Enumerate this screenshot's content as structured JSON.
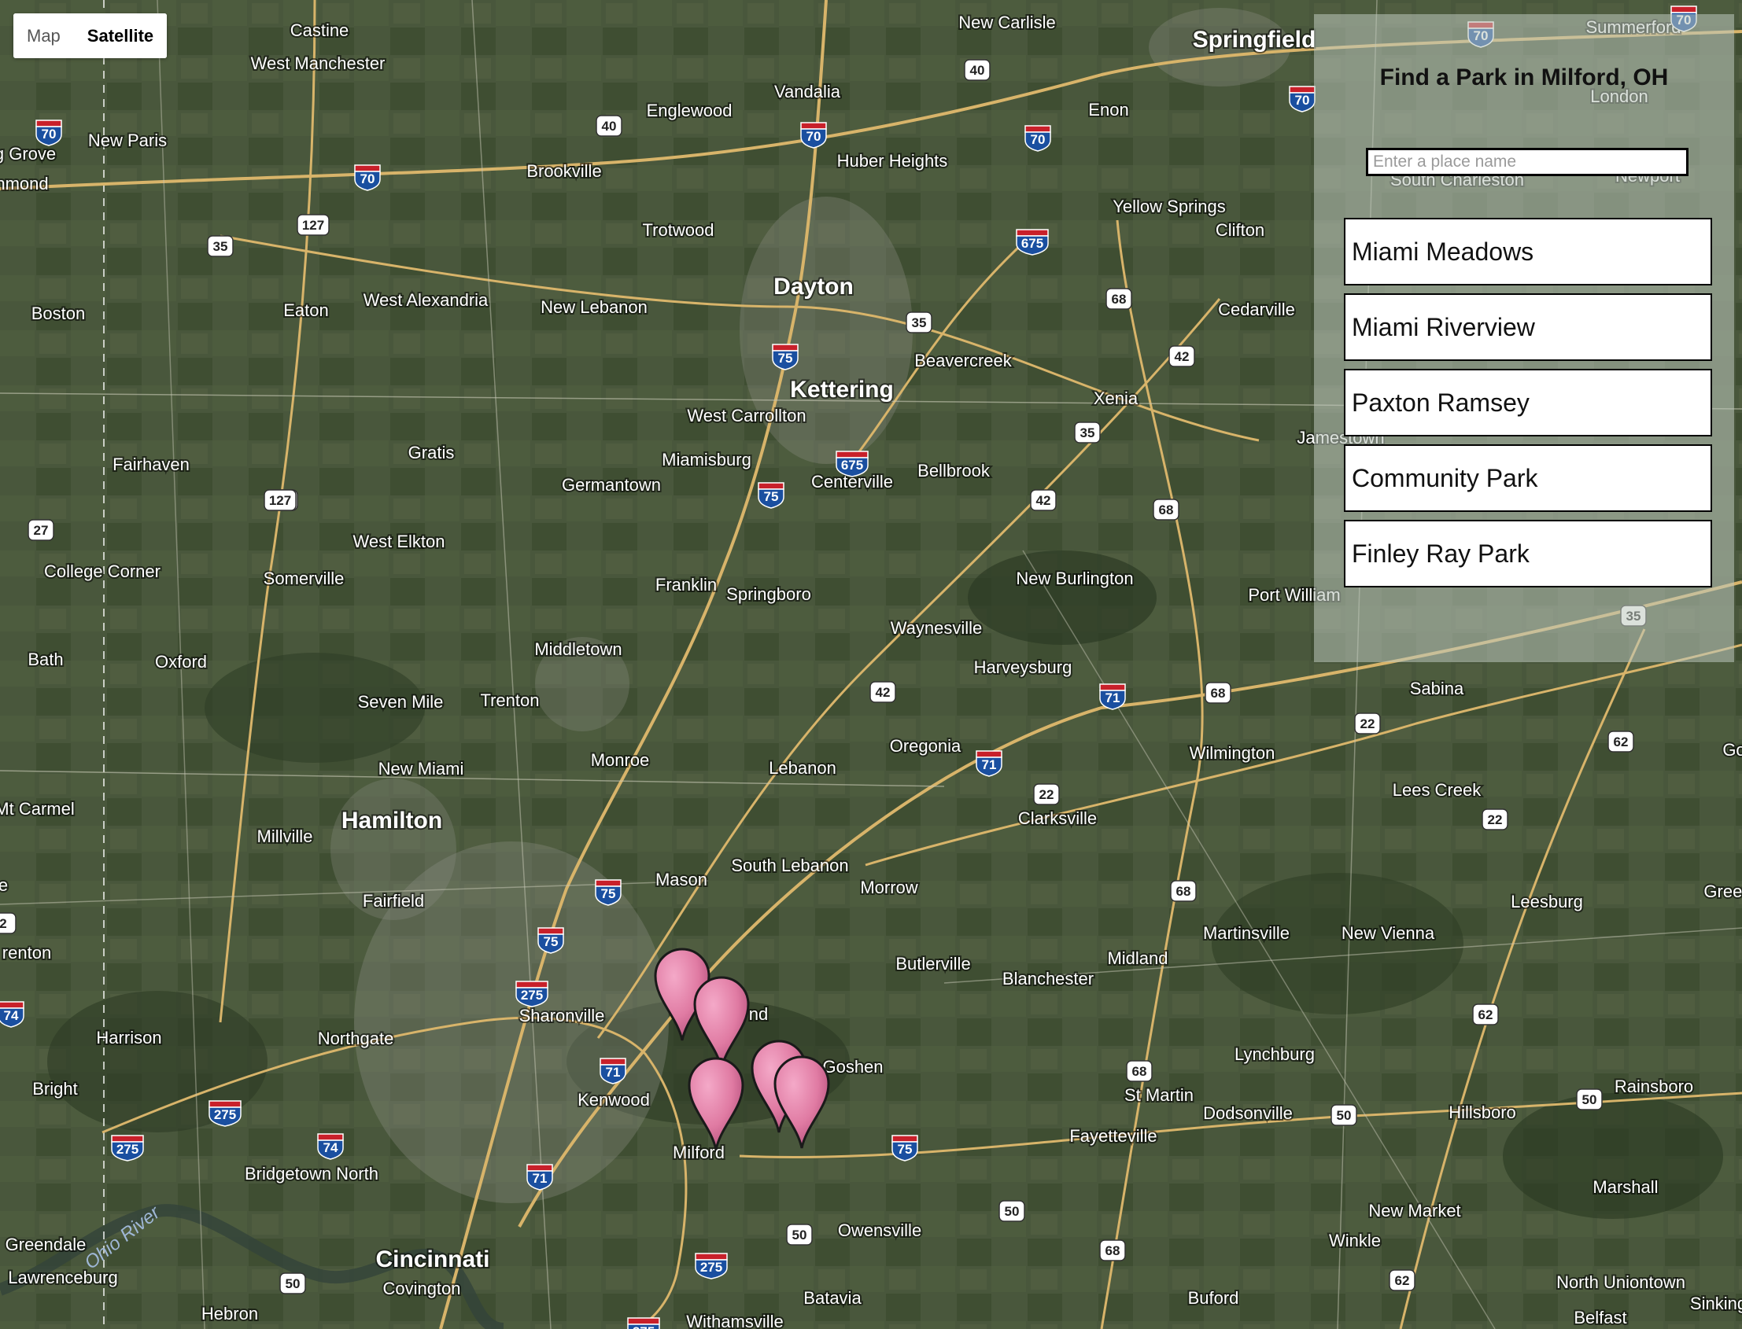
{
  "map_type_control": {
    "options": [
      "Map",
      "Satellite"
    ],
    "selected": "Satellite"
  },
  "panel": {
    "title": "Find a Park in Milford, OH",
    "search_placeholder": "Enter a place name",
    "search_value": "",
    "parks": [
      {
        "name": "Miami Meadows"
      },
      {
        "name": "Miami Riverview"
      },
      {
        "name": "Paxton Ramsey"
      },
      {
        "name": "Community Park"
      },
      {
        "name": "Finley Ray Park"
      }
    ]
  },
  "map": {
    "place_labels": [
      {
        "text": "Springfield",
        "major": true
      },
      {
        "text": "Dayton",
        "major": true
      },
      {
        "text": "Kettering",
        "major": true
      },
      {
        "text": "Hamilton",
        "major": true
      },
      {
        "text": "Cincinnati",
        "major": true
      },
      {
        "text": "Middletown",
        "major": false
      },
      {
        "text": "Xenia",
        "major": false
      },
      {
        "text": "Castine",
        "major": false
      },
      {
        "text": "West Manchester",
        "major": false
      },
      {
        "text": "New Carlisle",
        "major": false
      },
      {
        "text": "Summerford",
        "major": false
      },
      {
        "text": "London",
        "major": false
      },
      {
        "text": "Vandalia",
        "major": false
      },
      {
        "text": "Englewood",
        "major": false
      },
      {
        "text": "Enon",
        "major": false
      },
      {
        "text": "New Paris",
        "major": false
      },
      {
        "text": "g Grove",
        "major": false
      },
      {
        "text": "hmond",
        "major": false
      },
      {
        "text": "Brookville",
        "major": false
      },
      {
        "text": "Huber Heights",
        "major": false
      },
      {
        "text": "Yellow Springs",
        "major": false
      },
      {
        "text": "Clifton",
        "major": false
      },
      {
        "text": "South Charleston",
        "major": false
      },
      {
        "text": "Newport",
        "major": false
      },
      {
        "text": "Trotwood",
        "major": false
      },
      {
        "text": "Boston",
        "major": false
      },
      {
        "text": "Eaton",
        "major": false
      },
      {
        "text": "West Alexandria",
        "major": false
      },
      {
        "text": "New Lebanon",
        "major": false
      },
      {
        "text": "Cedarville",
        "major": false
      },
      {
        "text": "Beavercreek",
        "major": false
      },
      {
        "text": "West Carrollton",
        "major": false
      },
      {
        "text": "Miamisburg",
        "major": false
      },
      {
        "text": "Jamestown",
        "major": false
      },
      {
        "text": "Fairhaven",
        "major": false
      },
      {
        "text": "Gratis",
        "major": false
      },
      {
        "text": "Germantown",
        "major": false
      },
      {
        "text": "Centerville",
        "major": false
      },
      {
        "text": "Bellbrook",
        "major": false
      },
      {
        "text": "West Elkton",
        "major": false
      },
      {
        "text": "College Corner",
        "major": false
      },
      {
        "text": "Somerville",
        "major": false
      },
      {
        "text": "Franklin",
        "major": false
      },
      {
        "text": "Springboro",
        "major": false
      },
      {
        "text": "New Burlington",
        "major": false
      },
      {
        "text": "Port William",
        "major": false
      },
      {
        "text": "Bath",
        "major": false
      },
      {
        "text": "Oxford",
        "major": false
      },
      {
        "text": "Waynesville",
        "major": false
      },
      {
        "text": "Harveysburg",
        "major": false
      },
      {
        "text": "Seven Mile",
        "major": false
      },
      {
        "text": "Trenton",
        "major": false
      },
      {
        "text": "Sabina",
        "major": false
      },
      {
        "text": "Oregonia",
        "major": false
      },
      {
        "text": "Monroe",
        "major": false
      },
      {
        "text": "Lebanon",
        "major": false
      },
      {
        "text": "New Miami",
        "major": false
      },
      {
        "text": "Wilmington",
        "major": false
      },
      {
        "text": "Mt Carmel",
        "major": false
      },
      {
        "text": "Lees Creek",
        "major": false
      },
      {
        "text": "Millville",
        "major": false
      },
      {
        "text": "Clarksville",
        "major": false
      },
      {
        "text": "South Lebanon",
        "major": false
      },
      {
        "text": "Mason",
        "major": false
      },
      {
        "text": "Morrow",
        "major": false
      },
      {
        "text": "Fairfield",
        "major": false
      },
      {
        "text": "Leesburg",
        "major": false
      },
      {
        "text": "Martinsville",
        "major": false
      },
      {
        "text": "New Vienna",
        "major": false
      },
      {
        "text": "renton",
        "major": false
      },
      {
        "text": "Butlerville",
        "major": false
      },
      {
        "text": "Midland",
        "major": false
      },
      {
        "text": "Blanchester",
        "major": false
      },
      {
        "text": "Sharonville",
        "major": false
      },
      {
        "text": "Harrison",
        "major": false
      },
      {
        "text": "Northgate",
        "major": false
      },
      {
        "text": "nd",
        "major": false
      },
      {
        "text": "Goshen",
        "major": false
      },
      {
        "text": "Lynchburg",
        "major": false
      },
      {
        "text": "Bright",
        "major": false
      },
      {
        "text": "Kenwood",
        "major": false
      },
      {
        "text": "St Martin",
        "major": false
      },
      {
        "text": "Rainsboro",
        "major": false
      },
      {
        "text": "Dodsonville",
        "major": false
      },
      {
        "text": "Hillsboro",
        "major": false
      },
      {
        "text": "Fayetteville",
        "major": false
      },
      {
        "text": "Milford",
        "major": false
      },
      {
        "text": "Bridgetown North",
        "major": false
      },
      {
        "text": "Marshall",
        "major": false
      },
      {
        "text": "New Market",
        "major": false
      },
      {
        "text": "Owensville",
        "major": false
      },
      {
        "text": "Greendale",
        "major": false
      },
      {
        "text": "Winkle",
        "major": false
      },
      {
        "text": "Covington",
        "major": false
      },
      {
        "text": "Lawrenceburg",
        "major": false
      },
      {
        "text": "North Uniontown",
        "major": false
      },
      {
        "text": "Batavia",
        "major": false
      },
      {
        "text": "Buford",
        "major": false
      },
      {
        "text": "Hebron",
        "major": false
      },
      {
        "text": "Withamsville",
        "major": false
      },
      {
        "text": "Belfast",
        "major": false
      },
      {
        "text": "Sinking",
        "major": false
      },
      {
        "text": "Green",
        "major": false
      },
      {
        "text": "Go",
        "major": false
      },
      {
        "text": "e",
        "major": false
      }
    ],
    "river_labels": [
      "Ohio River"
    ],
    "route_shields": [
      {
        "number": "70",
        "kind": "interstate"
      },
      {
        "number": "70",
        "kind": "interstate"
      },
      {
        "number": "70",
        "kind": "interstate"
      },
      {
        "number": "70",
        "kind": "interstate"
      },
      {
        "number": "70",
        "kind": "interstate"
      },
      {
        "number": "70",
        "kind": "interstate"
      },
      {
        "number": "70",
        "kind": "interstate"
      },
      {
        "number": "675",
        "kind": "interstate"
      },
      {
        "number": "675",
        "kind": "interstate"
      },
      {
        "number": "75",
        "kind": "interstate"
      },
      {
        "number": "75",
        "kind": "interstate"
      },
      {
        "number": "75",
        "kind": "interstate"
      },
      {
        "number": "75",
        "kind": "interstate"
      },
      {
        "number": "75",
        "kind": "interstate"
      },
      {
        "number": "71",
        "kind": "interstate"
      },
      {
        "number": "71",
        "kind": "interstate"
      },
      {
        "number": "71",
        "kind": "interstate"
      },
      {
        "number": "71",
        "kind": "interstate"
      },
      {
        "number": "275",
        "kind": "interstate"
      },
      {
        "number": "275",
        "kind": "interstate"
      },
      {
        "number": "275",
        "kind": "interstate"
      },
      {
        "number": "275",
        "kind": "interstate"
      },
      {
        "number": "275",
        "kind": "interstate"
      },
      {
        "number": "74",
        "kind": "interstate"
      },
      {
        "number": "74",
        "kind": "interstate"
      },
      {
        "number": "40",
        "kind": "us"
      },
      {
        "number": "40",
        "kind": "us"
      },
      {
        "number": "35",
        "kind": "us"
      },
      {
        "number": "35",
        "kind": "us"
      },
      {
        "number": "35",
        "kind": "us"
      },
      {
        "number": "35",
        "kind": "us"
      },
      {
        "number": "127",
        "kind": "us"
      },
      {
        "number": "127",
        "kind": "us"
      },
      {
        "number": "127",
        "kind": "us"
      },
      {
        "number": "27",
        "kind": "us"
      },
      {
        "number": "42",
        "kind": "us"
      },
      {
        "number": "42",
        "kind": "us"
      },
      {
        "number": "42",
        "kind": "us"
      },
      {
        "number": "68",
        "kind": "us"
      },
      {
        "number": "68",
        "kind": "us"
      },
      {
        "number": "68",
        "kind": "us"
      },
      {
        "number": "68",
        "kind": "us"
      },
      {
        "number": "68",
        "kind": "us"
      },
      {
        "number": "68",
        "kind": "us"
      },
      {
        "number": "22",
        "kind": "us"
      },
      {
        "number": "22",
        "kind": "us"
      },
      {
        "number": "22",
        "kind": "us"
      },
      {
        "number": "62",
        "kind": "us"
      },
      {
        "number": "62",
        "kind": "us"
      },
      {
        "number": "62",
        "kind": "us"
      },
      {
        "number": "50",
        "kind": "us"
      },
      {
        "number": "50",
        "kind": "us"
      },
      {
        "number": "50",
        "kind": "us"
      },
      {
        "number": "50",
        "kind": "us"
      },
      {
        "number": "50",
        "kind": "us"
      },
      {
        "number": "2",
        "kind": "us"
      }
    ],
    "markers": [
      {
        "color": "#e07ba3"
      },
      {
        "color": "#e07ba3"
      },
      {
        "color": "#e07ba3"
      },
      {
        "color": "#e07ba3"
      },
      {
        "color": "#e07ba3"
      }
    ]
  },
  "colors": {
    "satellite_base": "#4a5a3a",
    "road_major": "#d8b46a",
    "marker_fill": "#e07ba3",
    "panel_bg": "#bec8be",
    "interstate_blue": "#1a4fa0",
    "interstate_red": "#c8202a"
  }
}
